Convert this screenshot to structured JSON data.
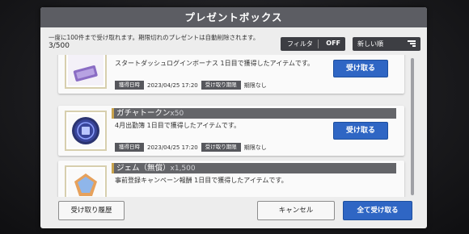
{
  "title": "プレゼントボックス",
  "info": {
    "notice": "一度に100件まで受け取れます。期限切れのプレゼントは自動削除されます。",
    "count": "3/500"
  },
  "filter": {
    "label": "フィルタ",
    "value": "OFF"
  },
  "sort": {
    "label": "新しい順",
    "icon": "sort-descending-icon"
  },
  "items": [
    {
      "name": "",
      "quantity": "",
      "description": "スタートダッシュログインボーナス 1日目で獲得したアイテムです。",
      "acquired_label": "獲得日時",
      "acquired_value": "2023/04/25 17:20",
      "expiry_label": "受け取り期限",
      "expiry_value": "期限なし",
      "receive_label": "受け取る",
      "icon": "ticket-icon"
    },
    {
      "name": "ガチャトークン",
      "quantity": "x50",
      "description": "4月出勤簿 1日目で獲得したアイテムです。",
      "acquired_label": "獲得日時",
      "acquired_value": "2023/04/25 17:20",
      "expiry_label": "受け取り期限",
      "expiry_value": "期限なし",
      "receive_label": "受け取る",
      "icon": "gacha-token-icon"
    },
    {
      "name": "ジェム（無償）",
      "quantity": "x1,500",
      "description": "事前登録キャンペーン報酬 1日目で獲得したアイテムです。",
      "acquired_label": "",
      "acquired_value": "",
      "expiry_label": "",
      "expiry_value": "",
      "receive_label": "",
      "icon": "gem-icon"
    }
  ],
  "buttons": {
    "history": "受け取り履歴",
    "cancel": "キャンセル",
    "receive_all": "全て受け取る"
  },
  "colors": {
    "primary_button": "#2f66c4",
    "title_bar": "#5c5d63",
    "accent": "#c9a34c"
  }
}
